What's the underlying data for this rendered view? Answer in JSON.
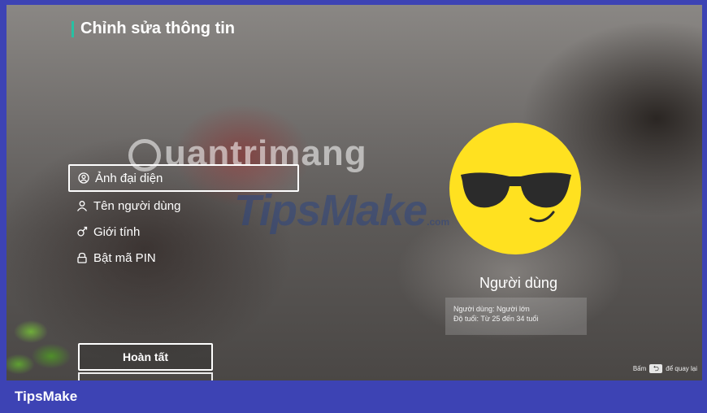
{
  "page": {
    "title": "Chỉnh sửa thông tin"
  },
  "menu": {
    "items": [
      {
        "label": "Ảnh đại diện",
        "icon": "avatar-circle-icon",
        "selected": true
      },
      {
        "label": "Tên người dùng",
        "icon": "person-icon",
        "selected": false
      },
      {
        "label": "Giới tính",
        "icon": "gender-icon",
        "selected": false
      },
      {
        "label": "Bật mã PIN",
        "icon": "lock-icon",
        "selected": false
      }
    ]
  },
  "buttons": {
    "done_label": "Hoàn tất"
  },
  "profile": {
    "name": "Người dùng",
    "details": [
      "Người dùng: Người lớn",
      "Độ tuổi: Từ 25 đến 34 tuổi"
    ],
    "avatar_color": "#ffe120"
  },
  "hint": {
    "press": "Bấm",
    "back_text": "để quay lại"
  },
  "watermarks": {
    "quantrimang": "uantrimang",
    "tipsmake": "TipsMake",
    "tipsmake_suffix": ".com"
  },
  "footer": {
    "brand": "TipsMake"
  },
  "colors": {
    "frame": "#3d43b4",
    "accent": "#27c1a3"
  }
}
